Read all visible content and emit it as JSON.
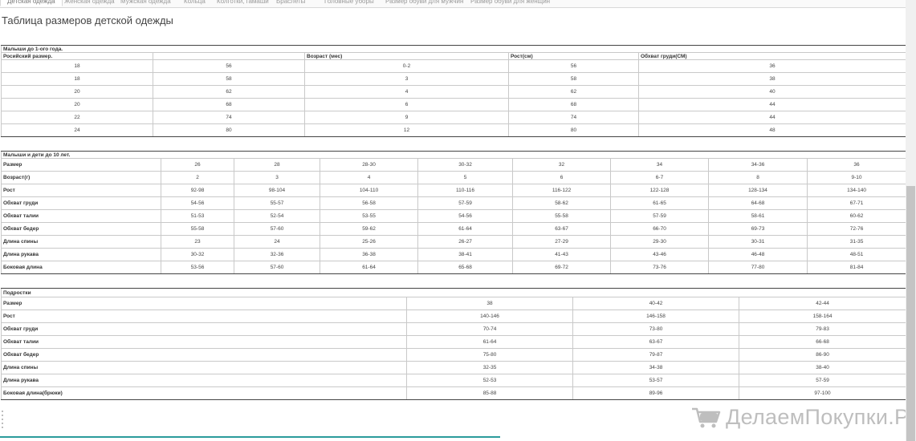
{
  "tabs": [
    {
      "label": "Детская одежда",
      "active": true
    },
    {
      "label": "Женская одежда",
      "active": false
    },
    {
      "label": "Мужская одежда",
      "active": false
    },
    {
      "label": "Кольца",
      "active": false
    },
    {
      "label": "Колготки, гамаши",
      "active": false
    },
    {
      "label": "Браслеты",
      "active": false
    },
    {
      "label": "Головные уборы",
      "active": false
    },
    {
      "label": "Размер обуви для мужчин",
      "active": false
    },
    {
      "label": "Размер обуви для женщин",
      "active": false
    }
  ],
  "page_title": "Таблица размеров детской одежды",
  "table1": {
    "caption": "Малыши до 1-ого года.",
    "headers": [
      "Росийский размер.",
      "",
      "Возраст (мес)",
      "Рост(см)",
      "Обхват груди(СМ)"
    ],
    "rows": [
      [
        "18",
        "56",
        "0-2",
        "56",
        "36"
      ],
      [
        "18",
        "58",
        "3",
        "58",
        "38"
      ],
      [
        "20",
        "62",
        "4",
        "62",
        "40"
      ],
      [
        "20",
        "68",
        "6",
        "68",
        "44"
      ],
      [
        "22",
        "74",
        "9",
        "74",
        "44"
      ],
      [
        "24",
        "80",
        "12",
        "80",
        "48"
      ]
    ]
  },
  "table2": {
    "caption": "Малыши и дети до 10 лет.",
    "rows": [
      {
        "label": "Размер",
        "values": [
          "26",
          "28",
          "28-30",
          "30-32",
          "32",
          "34",
          "34-36",
          "36"
        ]
      },
      {
        "label": "Возраст(г)",
        "values": [
          "2",
          "3",
          "4",
          "5",
          "6",
          "6-7",
          "8",
          "9-10"
        ]
      },
      {
        "label": "Рост",
        "values": [
          "92-98",
          "98-104",
          "104-110",
          "110-116",
          "116-122",
          "122-128",
          "128-134",
          "134-140"
        ]
      },
      {
        "label": "Обхват груди",
        "values": [
          "54-56",
          "55-57",
          "56-58",
          "57-59",
          "58-62",
          "61-65",
          "64-68",
          "67-71"
        ]
      },
      {
        "label": "Обхват талии",
        "values": [
          "51-53",
          "52-54",
          "53-55",
          "54-56",
          "55-58",
          "57-59",
          "58-61",
          "60-62"
        ]
      },
      {
        "label": "Обхват бедер",
        "values": [
          "55-58",
          "57-60",
          "59-62",
          "61-64",
          "63-67",
          "66-70",
          "69-73",
          "72-76"
        ]
      },
      {
        "label": "Длина спины",
        "values": [
          "23",
          "24",
          "25-26",
          "26-27",
          "27-29",
          "29-30",
          "30-31",
          "31-35"
        ]
      },
      {
        "label": "Длина рукава",
        "values": [
          "30-32",
          "32-36",
          "36-38",
          "38-41",
          "41-43",
          "43-46",
          "46-48",
          "48-51"
        ]
      },
      {
        "label": "Боковая длина",
        "values": [
          "53-56",
          "57-60",
          "61-64",
          "65-68",
          "69-72",
          "73-76",
          "77-80",
          "81-84"
        ]
      }
    ]
  },
  "table3": {
    "caption": "Подростки",
    "rows": [
      {
        "label": "Размер",
        "values": [
          "38",
          "40-42",
          "42-44"
        ]
      },
      {
        "label": "Рост",
        "values": [
          "140-146",
          "146-158",
          "158-164"
        ]
      },
      {
        "label": "Обхват груди",
        "values": [
          "70-74",
          "73-80",
          "79-83"
        ]
      },
      {
        "label": "Обхват талии",
        "values": [
          "61-64",
          "63-67",
          "66-68"
        ]
      },
      {
        "label": "Обхват бедер",
        "values": [
          "75-80",
          "79-87",
          "86-90"
        ]
      },
      {
        "label": "Длина спины",
        "values": [
          "32-35",
          "34-38",
          "38-40"
        ]
      },
      {
        "label": "Длина рукава",
        "values": [
          "52-53",
          "53-57",
          "57-59"
        ]
      },
      {
        "label": "Боковая длина(брюки)",
        "values": [
          "85-88",
          "89-96",
          "97-100"
        ]
      }
    ]
  },
  "watermark": {
    "text": "ДелаемПокупки.Ру",
    "icon": "shopping-cart-icon"
  },
  "colors": {
    "accent_line": "#2b9b9b",
    "table_border": "#c9c9c9"
  }
}
